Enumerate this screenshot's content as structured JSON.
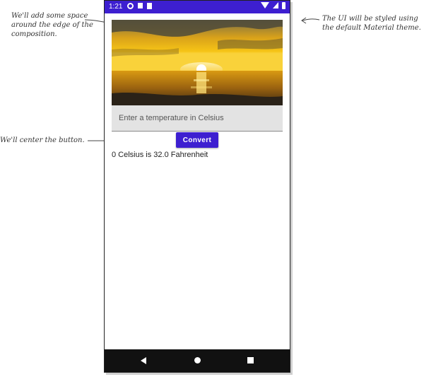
{
  "annotations": {
    "left_top": "We'll add some space around the edge of the composition.",
    "right_top": "The UI will be styled using the default Material theme.",
    "left_mid": "We'll center the button."
  },
  "status_bar": {
    "time": "1:21",
    "color": "#3d1fd0"
  },
  "temperature_input": {
    "value": "",
    "placeholder": "Enter a temperature in Celsius"
  },
  "convert_button": {
    "label": "Convert",
    "color": "#3d1fd0"
  },
  "result_text": "0 Celsius is 32.0 Fahrenheit",
  "navigation": {
    "icons": [
      "back-icon",
      "home-icon",
      "recents-icon"
    ]
  }
}
